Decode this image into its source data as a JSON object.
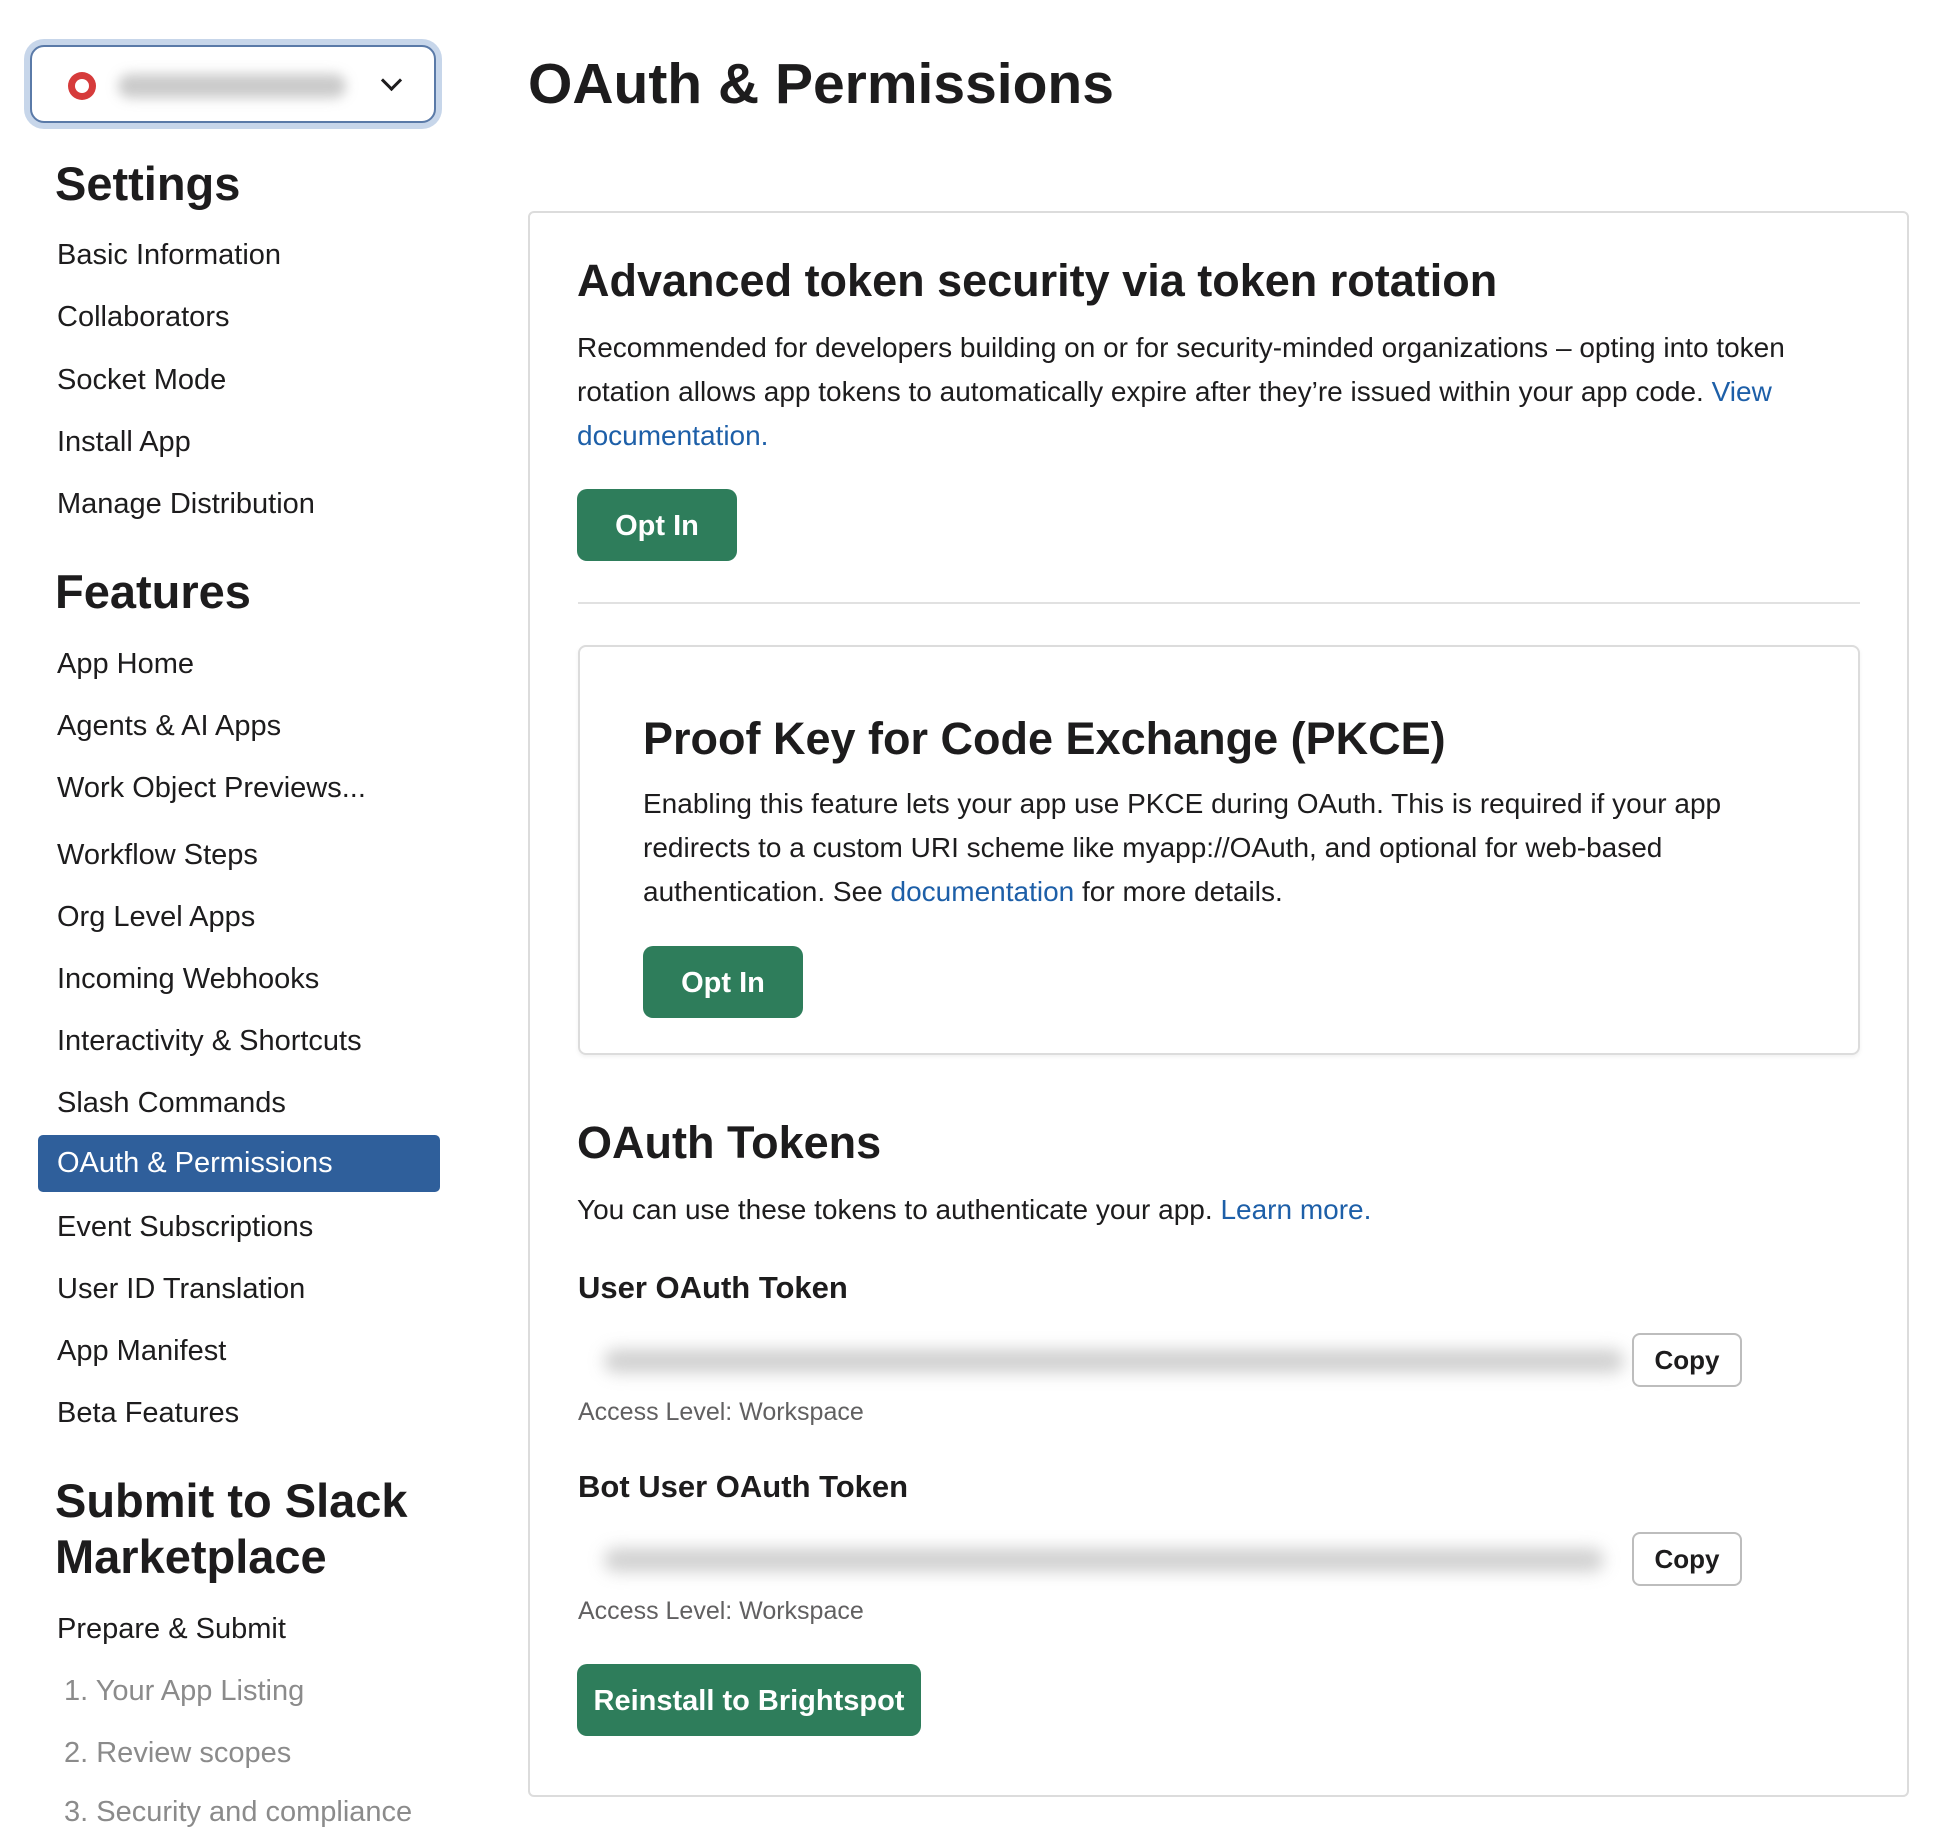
{
  "sidebar": {
    "settings_title": "Settings",
    "settings_items": [
      "Basic Information",
      "Collaborators",
      "Socket Mode",
      "Install App",
      "Manage Distribution"
    ],
    "features_title": "Features",
    "features_items": [
      "App Home",
      "Agents & AI Apps",
      "Work Object Previews...",
      "Workflow Steps",
      "Org Level Apps",
      "Incoming Webhooks",
      "Interactivity & Shortcuts",
      "Slash Commands",
      "OAuth & Permissions",
      "Event Subscriptions",
      "User ID Translation",
      "App Manifest",
      "Beta Features"
    ],
    "active_item": "OAuth & Permissions",
    "submit_title_line1": "Submit to Slack",
    "submit_title_line2": "Marketplace",
    "submit_items": [
      "Prepare & Submit",
      "1. Your App Listing",
      "2. Review scopes",
      "3. Security and compliance"
    ]
  },
  "main": {
    "title": "OAuth & Permissions",
    "token_rotation": {
      "heading": "Advanced token security via token rotation",
      "text": "Recommended for developers building on or for security-minded organizations – opting into token rotation allows app tokens to automatically expire after they’re issued within your app code.",
      "link": "View documentation.",
      "button": "Opt In"
    },
    "pkce": {
      "heading": "Proof Key for Code Exchange (PKCE)",
      "text": "Enabling this feature lets your app use PKCE during OAuth. This is required if your app redirects to a custom URI scheme like myapp://OAuth, and optional for web-based authentication. See",
      "link": "documentation",
      "text_after": "for more details.",
      "button": "Opt In"
    },
    "oauth_tokens": {
      "heading": "OAuth Tokens",
      "text": "You can use these tokens to authenticate your app.",
      "link": "Learn more.",
      "user_token_label": "User OAuth Token",
      "bot_token_label": "Bot User OAuth Token",
      "copy_label": "Copy",
      "access_level": "Access Level: Workspace",
      "reinstall_button": "Reinstall to Brightspot"
    }
  },
  "colors": {
    "accent_green": "#2e7d5b",
    "active_nav": "#2f5f9b",
    "link": "#1d5fa8"
  }
}
